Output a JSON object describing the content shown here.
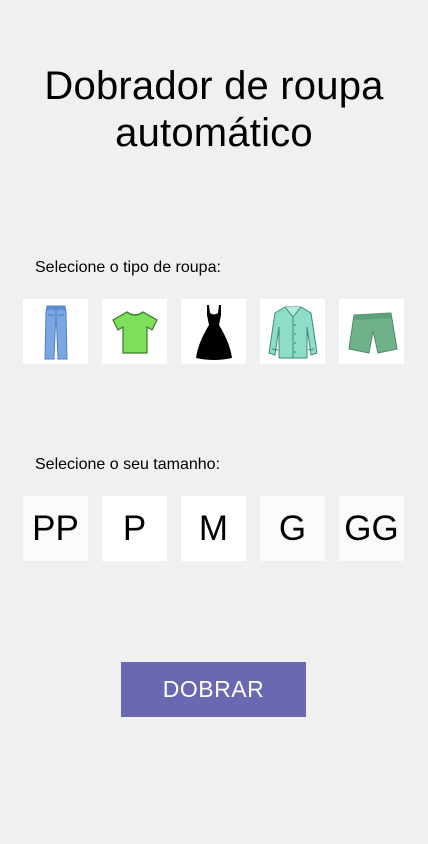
{
  "page": {
    "title_line1": "Dobrador de roupa",
    "title_line2": "automático",
    "background": "#f0f0f0"
  },
  "clothing_section": {
    "label": "Selecione o tipo de roupa:",
    "items": [
      {
        "icon": "jeans-icon",
        "color": "#7aa6e4"
      },
      {
        "icon": "t-shirt-icon",
        "color": "#7ee05a"
      },
      {
        "icon": "dress-icon",
        "color": "#000000"
      },
      {
        "icon": "dress-shirt-icon",
        "color": "#8fdcc8"
      },
      {
        "icon": "shorts-icon",
        "color": "#6fb28a"
      }
    ]
  },
  "size_section": {
    "label": "Selecione o seu tamanho:",
    "sizes": [
      "PP",
      "P",
      "M",
      "G",
      "GG"
    ]
  },
  "action": {
    "label": "DOBRAR",
    "color": "#6a68b1"
  }
}
